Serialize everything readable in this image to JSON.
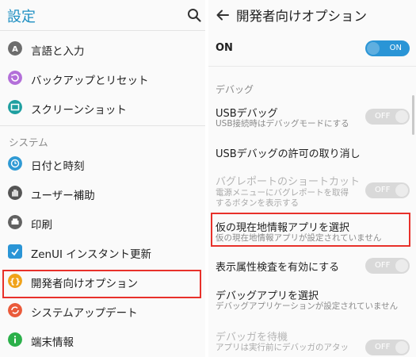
{
  "left": {
    "title": "設定",
    "items_top": [
      {
        "label": "言語と入力",
        "icon": "language-icon",
        "color": "#6d6d6d"
      },
      {
        "label": "バックアップとリセット",
        "icon": "backup-icon",
        "color": "#b36fd9"
      },
      {
        "label": "スクリーンショット",
        "icon": "screenshot-icon",
        "color": "#1e9fa0"
      }
    ],
    "section_system": "システム",
    "items_system": [
      {
        "label": "日付と時刻",
        "icon": "clock-icon",
        "color": "#2f9ad4"
      },
      {
        "label": "ユーザー補助",
        "icon": "hand-icon",
        "color": "#555555"
      },
      {
        "label": "印刷",
        "icon": "print-icon",
        "color": "#616161"
      },
      {
        "label": "ZenUI インスタント更新",
        "icon": "update-icon",
        "color": "#2a95d6"
      },
      {
        "label": "開発者向けオプション",
        "icon": "developer-icon",
        "color": "#f0a21a"
      },
      {
        "label": "システムアップデート",
        "icon": "system-update-icon",
        "color": "#ea5a3a"
      },
      {
        "label": "端末情報",
        "icon": "info-icon",
        "color": "#2bb04a"
      }
    ]
  },
  "right": {
    "title": "開発者向けオプション",
    "master": {
      "label": "ON",
      "toggle": "ON"
    },
    "section_debug": "デバッグ",
    "usb_debug": {
      "title": "USBデバッグ",
      "sub": "USB接続時はデバッグモードにする",
      "toggle": "OFF"
    },
    "usb_revoke": {
      "title": "USBデバッグの許可の取り消し"
    },
    "bugreport": {
      "title": "バグレポートのショートカット",
      "sub1": "電源メニューにバグレポートを取得",
      "sub2": "するボタンを表示する",
      "toggle": "OFF"
    },
    "mock_location": {
      "title": "仮の現在地情報アプリを選択",
      "sub": "仮の現在地情報アプリが設定されていません"
    },
    "view_attr": {
      "title": "表示属性検査を有効にする",
      "toggle": "OFF"
    },
    "debug_app": {
      "title": "デバッグアプリを選択",
      "sub": "デバッグアプリケーションが設定されていません"
    },
    "wait_debugger": {
      "title": "デバッガを待機",
      "sub": "アプリは実行前にデバッガのアタッ",
      "toggle": "OFF"
    }
  },
  "colors": {
    "accent": "#1e8fc2",
    "toggle_on": "#2a95d6",
    "highlight": "#e8312a"
  }
}
